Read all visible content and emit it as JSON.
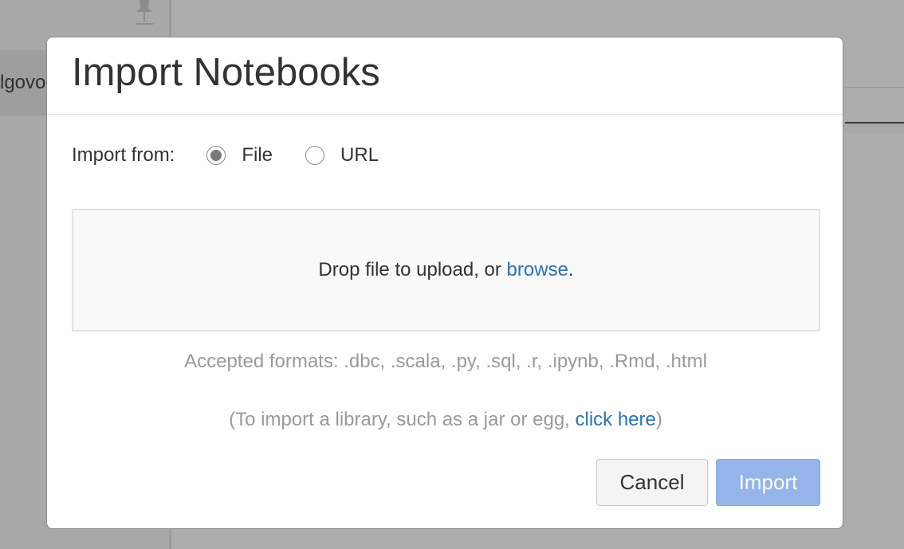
{
  "background": {
    "sidebar_partial_text": "lgovo",
    "pin_icon": "pin-icon"
  },
  "modal": {
    "title": "Import Notebooks",
    "import_from_label": "Import from:",
    "options": [
      {
        "label": "File",
        "selected": true
      },
      {
        "label": "URL",
        "selected": false
      }
    ],
    "dropzone": {
      "text_before": "Drop file to upload, or ",
      "browse_link": "browse",
      "text_after": "."
    },
    "accepted_formats": "Accepted formats: .dbc, .scala, .py, .sql, .r, .ipynb, .Rmd, .html",
    "library_note": {
      "before": "(To import a library, such as a jar or egg, ",
      "link": "click here",
      "after": ")"
    },
    "buttons": {
      "cancel": "Cancel",
      "import": "Import"
    }
  },
  "colors": {
    "link": "#2a72b5",
    "import_button_disabled": "#94b4ea",
    "overlay": "#acacac"
  }
}
